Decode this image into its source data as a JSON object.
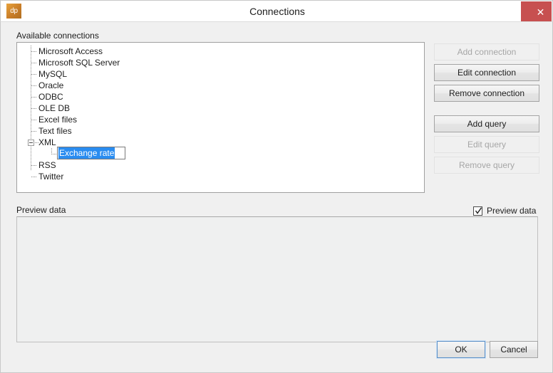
{
  "window": {
    "title": "Connections",
    "app_icon": "dp",
    "close_icon": "✕"
  },
  "available_connections": {
    "label": "Available connections",
    "tree": [
      {
        "label": "Microsoft Access",
        "level": 0,
        "expander": "none"
      },
      {
        "label": "Microsoft SQL Server",
        "level": 0,
        "expander": "none"
      },
      {
        "label": "MySQL",
        "level": 0,
        "expander": "none"
      },
      {
        "label": "Oracle",
        "level": 0,
        "expander": "none"
      },
      {
        "label": "ODBC",
        "level": 0,
        "expander": "none"
      },
      {
        "label": "OLE DB",
        "level": 0,
        "expander": "none"
      },
      {
        "label": "Excel files",
        "level": 0,
        "expander": "none"
      },
      {
        "label": "Text files",
        "level": 0,
        "expander": "none"
      },
      {
        "label": "XML",
        "level": 0,
        "expander": "minus"
      },
      {
        "label": "Exchange rate",
        "level": 1,
        "expander": "none",
        "editing": true,
        "selected": true
      },
      {
        "label": "RSS",
        "level": 0,
        "expander": "none"
      },
      {
        "label": "Twitter",
        "level": 0,
        "expander": "none"
      }
    ],
    "editing_value": "Exchange rate"
  },
  "connection_buttons": {
    "add_connection": {
      "label": "Add connection",
      "enabled": false
    },
    "edit_connection": {
      "label": "Edit connection",
      "enabled": true
    },
    "remove_connection": {
      "label": "Remove connection",
      "enabled": true
    },
    "add_query": {
      "label": "Add query",
      "enabled": true
    },
    "edit_query": {
      "label": "Edit query",
      "enabled": false
    },
    "remove_query": {
      "label": "Remove query",
      "enabled": false
    }
  },
  "preview": {
    "label": "Preview data",
    "checkbox_label": "Preview data",
    "checked": true,
    "content": ""
  },
  "dialog_buttons": {
    "ok": "OK",
    "cancel": "Cancel"
  },
  "colors": {
    "accent_selection": "#2a8cf0",
    "close_button": "#c75050",
    "app_icon": "#c87d28",
    "dialog_background": "#f0f0f0",
    "panel_background": "#ffffff",
    "preview_background": "#eff0f0",
    "focus_border": "#5a8fc7",
    "disabled_text": "#a6a6a6"
  }
}
